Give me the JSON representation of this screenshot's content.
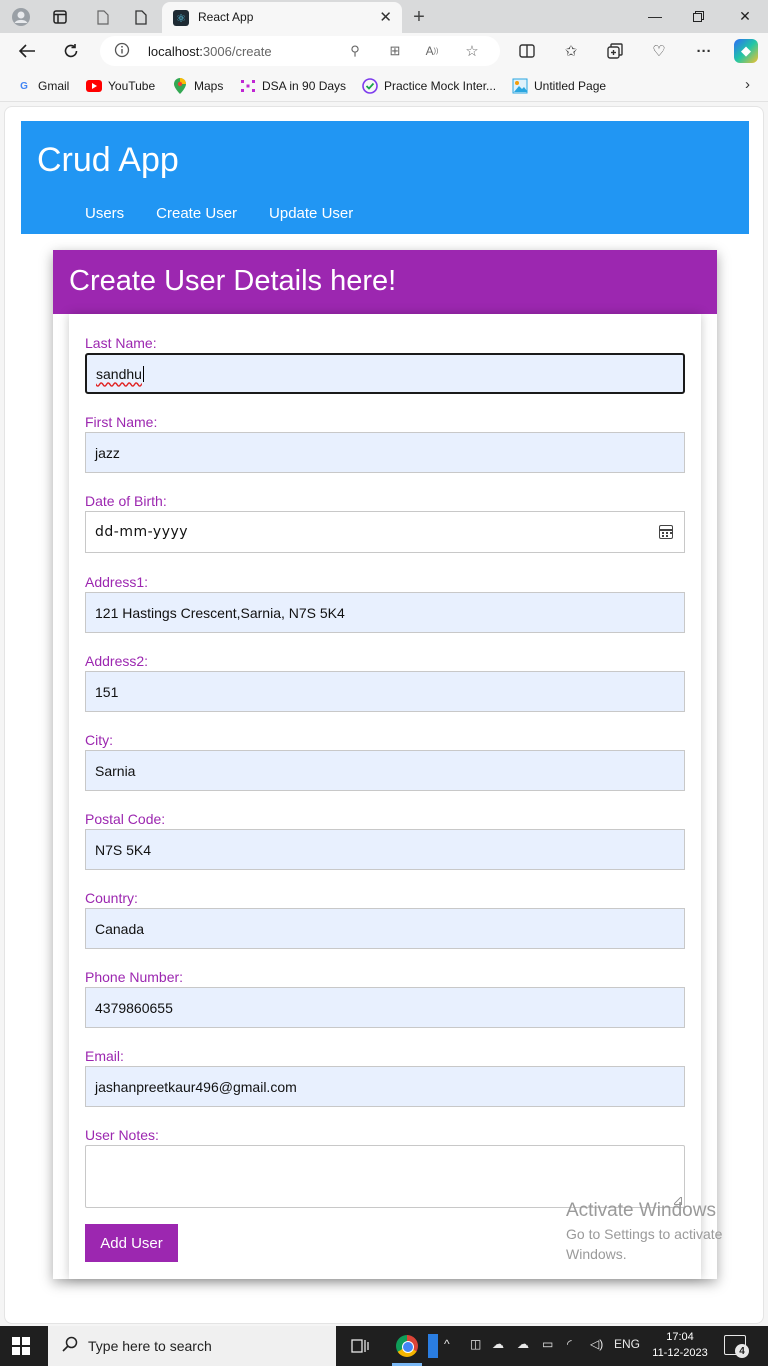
{
  "browser": {
    "tab_title": "React App",
    "url_host": "localhost:",
    "url_path": "3006/create",
    "bookmarks": [
      {
        "label": "Gmail",
        "icon": "google-icon",
        "color": "#4285f4"
      },
      {
        "label": "YouTube",
        "icon": "youtube-icon",
        "color": "#ff0000"
      },
      {
        "label": "Maps",
        "icon": "maps-pin-icon",
        "color": "#34a853"
      },
      {
        "label": "DSA in 90 Days",
        "icon": "dots-grid-icon",
        "color": "#c026d3"
      },
      {
        "label": "Practice Mock Inter...",
        "icon": "checkmark-badge-icon",
        "color": "#7c3aed"
      },
      {
        "label": "Untitled Page",
        "icon": "page-image-icon",
        "color": "#2aa6e0"
      }
    ]
  },
  "app": {
    "title": "Crud App",
    "nav": [
      "Users",
      "Create User",
      "Update User"
    ],
    "header_color": "#2196f3",
    "accent_color": "#9c27b0"
  },
  "form": {
    "title": "Create User Details here!",
    "fields": {
      "last_name": {
        "label": "Last Name:",
        "value": "sandhu"
      },
      "first_name": {
        "label": "First Name:",
        "value": "jazz"
      },
      "dob": {
        "label": "Date of Birth:",
        "placeholder": "dd-mm-yyyy"
      },
      "address1": {
        "label": "Address1:",
        "value": "121 Hastings Crescent,Sarnia, N7S 5K4"
      },
      "address2": {
        "label": "Address2:",
        "value": "151"
      },
      "city": {
        "label": "City:",
        "value": "Sarnia"
      },
      "postal_code": {
        "label": "Postal Code:",
        "value": "N7S 5K4"
      },
      "country": {
        "label": "Country:",
        "value": "Canada"
      },
      "phone": {
        "label": "Phone Number:",
        "value": "4379860655"
      },
      "email": {
        "label": "Email:",
        "value": "jashanpreetkaur496@gmail.com"
      },
      "notes": {
        "label": "User Notes:",
        "value": ""
      }
    },
    "submit_label": "Add User"
  },
  "watermark": {
    "title": "Activate Windows",
    "line1": "Go to Settings to activate",
    "line2": "Windows."
  },
  "taskbar": {
    "search_placeholder": "Type here to search",
    "language": "ENG",
    "time": "17:04",
    "date": "11-12-2023",
    "notification_count": "4"
  }
}
